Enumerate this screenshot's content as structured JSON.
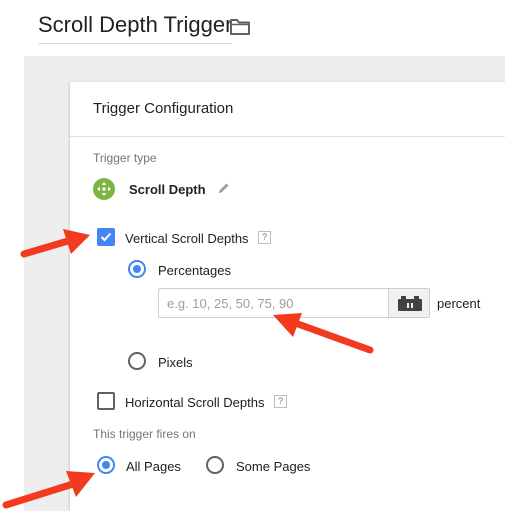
{
  "header": {
    "title": "Scroll Depth Trigger"
  },
  "card": {
    "title": "Trigger Configuration",
    "trigger_type": {
      "label": "Trigger type",
      "name": "Scroll Depth",
      "icon": "scroll-depth-icon",
      "icon_color": "#7cb342"
    },
    "vertical": {
      "label": "Vertical Scroll Depths",
      "help": "?",
      "checked": true,
      "options": {
        "percentages_label": "Percentages",
        "pixels_label": "Pixels",
        "selected": "Percentages"
      },
      "input": {
        "value": "",
        "placeholder": "e.g. 10, 25, 50, 75, 90",
        "unit": "percent"
      }
    },
    "horizontal": {
      "label": "Horizontal Scroll Depths",
      "help": "?",
      "checked": false
    },
    "fires_on": {
      "label": "This trigger fires on",
      "options": [
        "All Pages",
        "Some Pages"
      ],
      "selected": "All Pages"
    }
  },
  "colors": {
    "accent": "#4285f4",
    "annotation_arrow": "#f23a1f"
  }
}
